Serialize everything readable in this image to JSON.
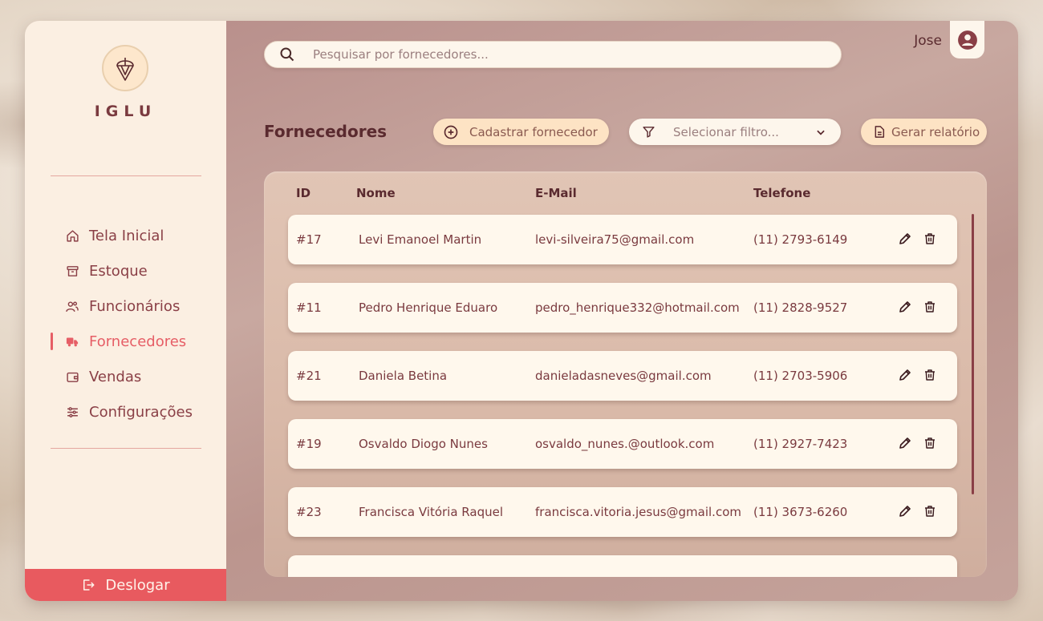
{
  "brand": {
    "name": "IGLU"
  },
  "sidebar": {
    "items": [
      {
        "label": "Tela Inicial",
        "icon": "home-icon",
        "active": false
      },
      {
        "label": "Estoque",
        "icon": "archive-icon",
        "active": false
      },
      {
        "label": "Funcionários",
        "icon": "users-icon",
        "active": false
      },
      {
        "label": "Fornecedores",
        "icon": "truck-icon",
        "active": true
      },
      {
        "label": "Vendas",
        "icon": "wallet-icon",
        "active": false
      },
      {
        "label": "Configurações",
        "icon": "sliders-icon",
        "active": false
      }
    ],
    "logout_label": "Deslogar"
  },
  "search": {
    "placeholder": "Pesquisar por fornecedores..."
  },
  "user": {
    "name": "Jose"
  },
  "page": {
    "title": "Fornecedores"
  },
  "toolbar": {
    "add_label": "Cadastrar fornecedor",
    "filter_placeholder": "Selecionar filtro...",
    "report_label": "Gerar relatório"
  },
  "table": {
    "columns": {
      "id": "ID",
      "name": "Nome",
      "email": "E-Mail",
      "phone": "Telefone"
    },
    "rows": [
      {
        "id": "#17",
        "name": "Levi Emanoel Martin",
        "email": "levi-silveira75@gmail.com",
        "phone": "(11) 2793-6149"
      },
      {
        "id": "#11",
        "name": "Pedro Henrique Eduaro",
        "email": "pedro_henrique332@hotmail.com",
        "phone": "(11) 2828-9527"
      },
      {
        "id": "#21",
        "name": "Daniela Betina",
        "email": "danieladasneves@gmail.com",
        "phone": "(11) 2703-5906"
      },
      {
        "id": "#19",
        "name": "Osvaldo Diogo Nunes",
        "email": "osvaldo_nunes.@outlook.com",
        "phone": "(11) 2927-7423"
      },
      {
        "id": "#23",
        "name": "Francisca Vitória Raquel",
        "email": "francisca.vitoria.jesus@gmail.com",
        "phone": "(11) 3673-6260"
      }
    ]
  },
  "colors": {
    "accent": "#e65e66",
    "text_dark": "#5a2a2f",
    "logout_bg": "#e85a5f"
  }
}
